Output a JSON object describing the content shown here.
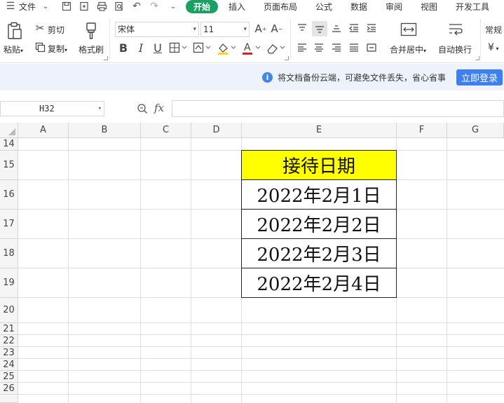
{
  "menu": {
    "file_label": "文件",
    "tabs": [
      "开始",
      "插入",
      "页面布局",
      "公式",
      "数据",
      "审阅",
      "视图",
      "开发工具"
    ]
  },
  "ribbon": {
    "cut_label": "剪切",
    "copy_label": "复制",
    "paste_label": "粘贴",
    "format_painter_label": "格式刷",
    "font_name": "宋体",
    "font_size": "11",
    "merge_center_label": "合并居中",
    "wrap_text_label": "自动换行",
    "number_format": "常规",
    "currency_symbol": "¥"
  },
  "notice": {
    "text": "将文档备份云端，可避免文件丢失，省心省事",
    "login_button": "立即登录"
  },
  "formula_bar": {
    "cell_ref": "H32",
    "fx_label": "fx",
    "value": ""
  },
  "grid": {
    "columns": [
      "A",
      "B",
      "C",
      "D",
      "E",
      "F",
      "G"
    ],
    "rows": [
      "14",
      "15",
      "16",
      "17",
      "18",
      "19",
      "20",
      "21",
      "22",
      "23",
      "24",
      "25",
      "26"
    ],
    "table": {
      "header": "接待日期",
      "values": [
        "2022年2月1日",
        "2022年2月2日",
        "2022年2月3日",
        "2022年2月4日"
      ]
    }
  },
  "colors": {
    "accent_green": "#1aa062",
    "header_fill": "#ffff00",
    "login_blue": "#3d7ff0"
  }
}
